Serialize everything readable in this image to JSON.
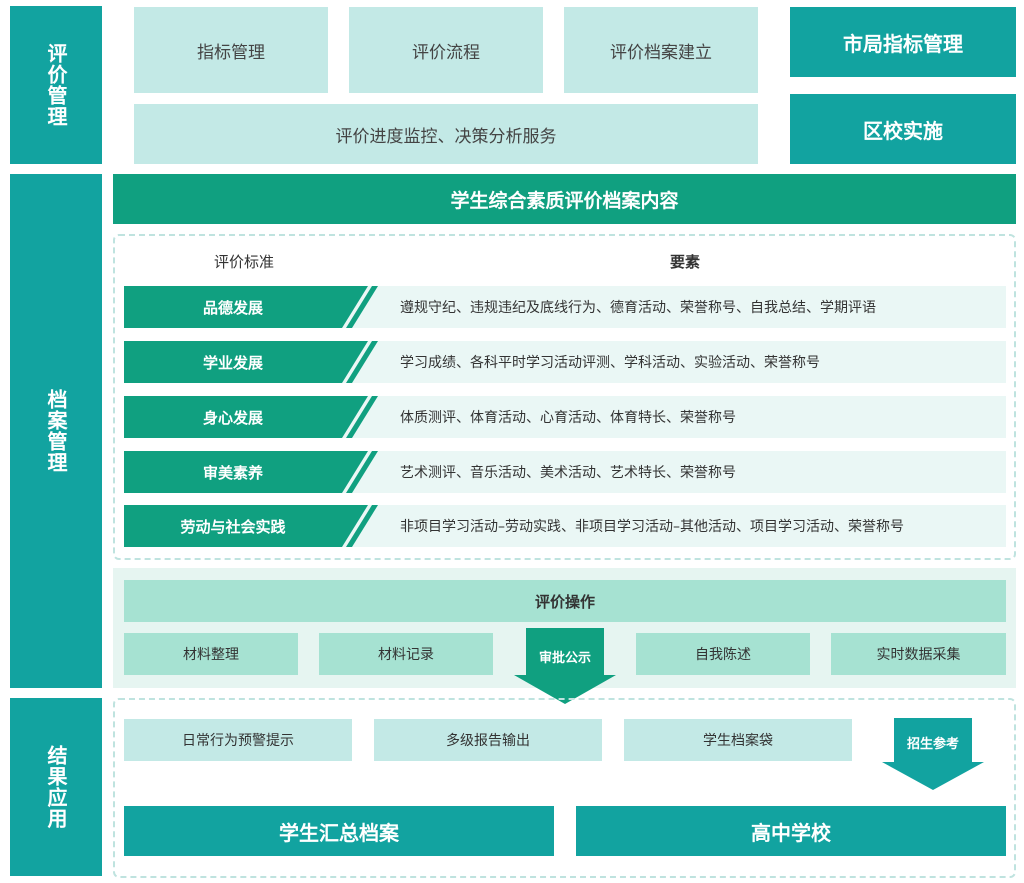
{
  "sections": {
    "eval_mgmt": "评价管理",
    "archive_mgmt": "档案管理",
    "result_app": "结果应用"
  },
  "top": {
    "indicator_mgmt": "指标管理",
    "eval_process": "评价流程",
    "archive_build": "评价档案建立",
    "monitor": "评价进度监控、决策分析服务",
    "city_indicator": "市局指标管理",
    "district_school": "区校实施"
  },
  "archive": {
    "title": "学生综合素质评价档案内容",
    "col_standard": "评价标准",
    "col_elements": "要素",
    "rows": [
      {
        "name": "品德发展",
        "elements": "遵规守纪、违规违纪及底线行为、德育活动、荣誉称号、自我总结、学期评语"
      },
      {
        "name": "学业发展",
        "elements": "学习成绩、各科平时学习活动评测、学科活动、实验活动、荣誉称号"
      },
      {
        "name": "身心发展",
        "elements": "体质测评、体育活动、心育活动、体育特长、荣誉称号"
      },
      {
        "name": "审美素养",
        "elements": "艺术测评、音乐活动、美术活动、艺术特长、荣誉称号"
      },
      {
        "name": "劳动与社会实践",
        "elements": "非项目学习活动–劳动实践、非项目学习活动–其他活动、项目学习活动、荣誉称号"
      }
    ]
  },
  "operations": {
    "title": "评价操作",
    "items": [
      "材料整理",
      "材料记录",
      "审批公示",
      "自我陈述",
      "实时数据采集"
    ]
  },
  "results": {
    "items": [
      "日常行为预警提示",
      "多级报告输出",
      "学生档案袋"
    ],
    "arrow_label": "招生参考",
    "summary": "学生汇总档案",
    "high_school": "高中学校"
  },
  "colors": {
    "teal": "#12a3a0",
    "green": "#10a080",
    "light": "#c3e9e6",
    "op_light": "#a6e2d2"
  }
}
